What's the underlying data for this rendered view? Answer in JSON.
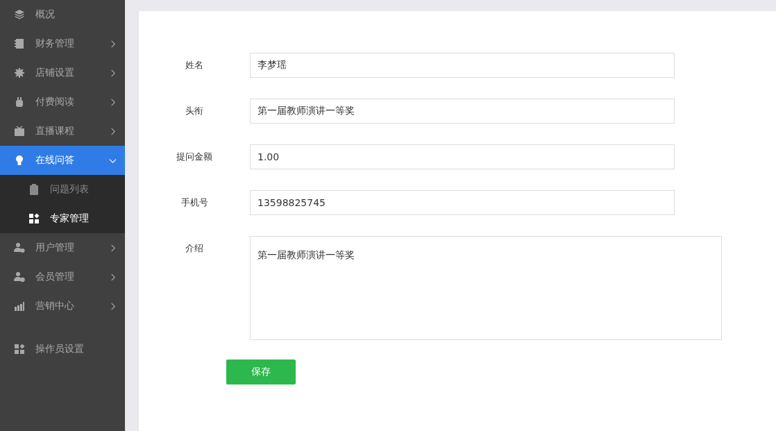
{
  "sidebar": {
    "items": [
      {
        "label": "概况",
        "kind": "link",
        "selected": false
      },
      {
        "label": "财务管理",
        "kind": "group",
        "selected": false,
        "expanded": false
      },
      {
        "label": "店铺设置",
        "kind": "group",
        "selected": false,
        "expanded": false
      },
      {
        "label": "付费阅读",
        "kind": "group",
        "selected": false,
        "expanded": false
      },
      {
        "label": "直播课程",
        "kind": "group",
        "selected": false,
        "expanded": false
      },
      {
        "label": "在线问答",
        "kind": "group",
        "selected": true,
        "expanded": true,
        "children": [
          {
            "label": "问题列表",
            "selected": false
          },
          {
            "label": "专家管理",
            "selected": true
          }
        ]
      },
      {
        "label": "用户管理",
        "kind": "group",
        "selected": false,
        "expanded": false
      },
      {
        "label": "会员管理",
        "kind": "group",
        "selected": false,
        "expanded": false
      },
      {
        "label": "营销中心",
        "kind": "group",
        "selected": false,
        "expanded": false
      }
    ],
    "bottom_items": [
      {
        "label": "操作员设置",
        "selected": false
      }
    ]
  },
  "form": {
    "fields": [
      {
        "label": "姓名",
        "kind": "input",
        "value": "李梦瑶"
      },
      {
        "label": "头衔",
        "kind": "input",
        "value": "第一届教师演讲一等奖"
      },
      {
        "label": "提问金额",
        "kind": "input",
        "value": "1.00"
      },
      {
        "label": "手机号",
        "kind": "input",
        "value": "13598825745"
      },
      {
        "label": "介绍",
        "kind": "textarea",
        "value": "第一届教师演讲一等奖"
      }
    ],
    "submit": "保存"
  }
}
